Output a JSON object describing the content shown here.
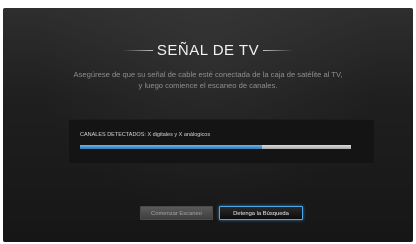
{
  "screen": {
    "title": "SEÑAL DE TV",
    "instruction_line1": "Asegúrese de que su señal de cable esté conectada de la caja de satélite al TV,",
    "instruction_line2": "y luego comience el escaneo de canales."
  },
  "scan": {
    "channels_label": "CANALES DETECTADOS: X digitales y X análogicos",
    "progress": 0.67
  },
  "buttons": {
    "start_label": "Comenzar Escaneo",
    "stop_label": "Detenga la Búsqueda"
  },
  "colors": {
    "accent": "#4ea6e6",
    "progress_fill": "#3a8ed0",
    "background": "#1f1f1f"
  }
}
